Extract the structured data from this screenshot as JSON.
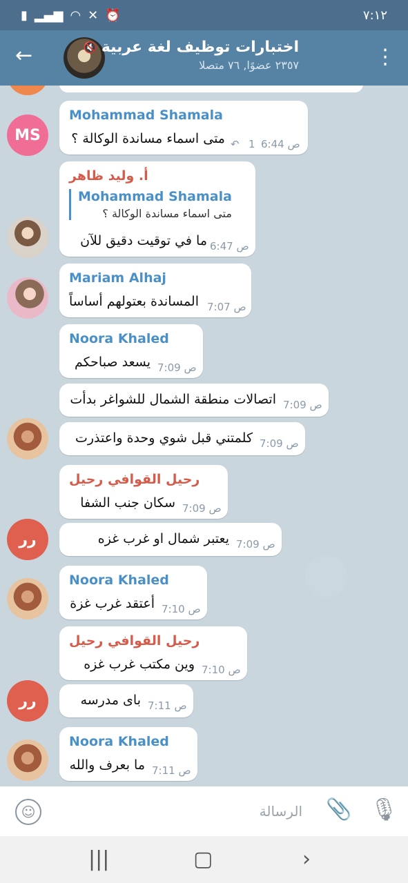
{
  "status_bar": {
    "time": "٧:١٢"
  },
  "header": {
    "title": "اختبارات توظيف لغة عربية",
    "subtitle": "٢٣٥٧ عضوًا, ٧٦ متصلا"
  },
  "messages": [
    {
      "avatar_text": "MS",
      "sender": "Mohammad Shamala",
      "text": "متى اسماء مساندة الوكالة ؟",
      "time": "6:44 ص",
      "replies": "1"
    },
    {
      "sender": "أ. وليد ظاهر",
      "quote_name": "Mohammad Shamala",
      "quote_text": "متى اسماء مساندة الوكالة ؟",
      "text": "ما في توقيت دقيق للآن",
      "time": "6:47 ص"
    },
    {
      "sender": "Mariam Alhaj",
      "text": "المساندة بعتولهم أساساً",
      "time": "7:07 ص"
    },
    {
      "sender": "Noora Khaled",
      "text": "يسعد صباحكم",
      "time": "7:09 ص"
    },
    {
      "text": "اتصالات منطقة الشمال للشواغر بدأت",
      "time": "7:09 ص"
    },
    {
      "text": "كلمتني قبل شوي وحدة واعتذرت",
      "time": "7:09 ص"
    },
    {
      "sender": "رحيل القوافي رحيل",
      "text": "سكان  جنب  الشفا",
      "time": "7:09 ص"
    },
    {
      "avatar_text": "رر",
      "text": "يعتبر  شمال  او   غرب  غزه",
      "time": "7:09 ص"
    },
    {
      "sender": "Noora Khaled",
      "text": "أعتقد غرب غزة",
      "time": "7:10 ص"
    },
    {
      "sender": "رحيل القوافي رحيل",
      "text": "وين مكتب  غرب   غزه",
      "time": "7:10 ص"
    },
    {
      "avatar_text": "رر",
      "text": "باى   مدرسه",
      "time": "7:11 ص"
    },
    {
      "sender": "Noora Khaled",
      "text": "ما بعرف والله",
      "time": "7:11 ص"
    }
  ],
  "composer": {
    "placeholder": "الرسالة"
  }
}
